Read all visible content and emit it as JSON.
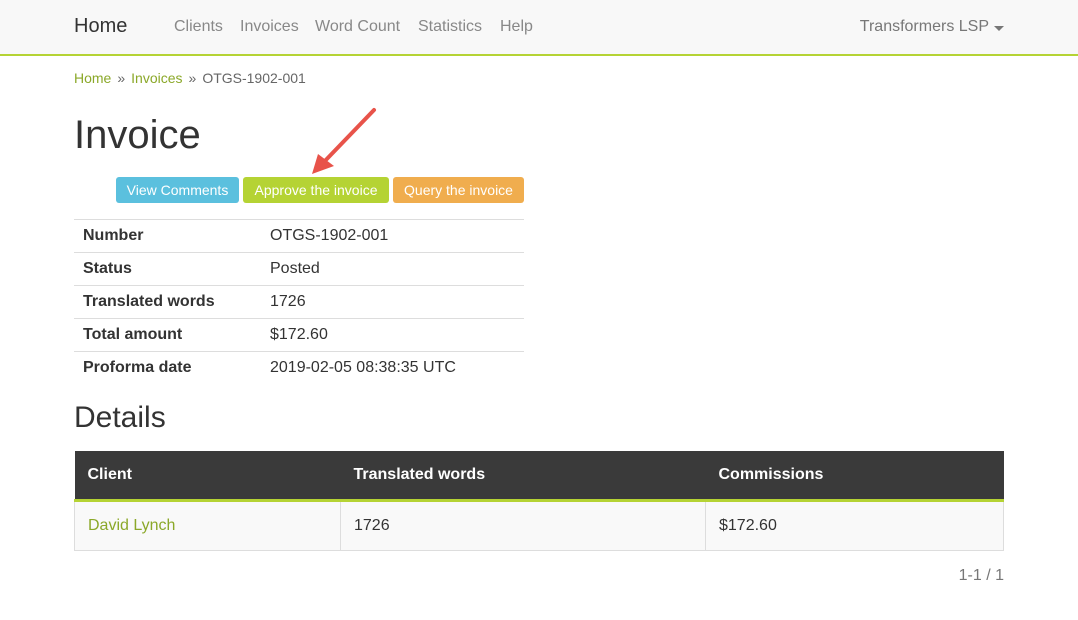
{
  "navbar": {
    "brand": "Home",
    "links": [
      "Clients",
      "Invoices",
      "Word Count",
      "Statistics",
      "Help"
    ],
    "user": "Transformers LSP"
  },
  "breadcrumb": {
    "home": "Home",
    "separator": "»",
    "invoices": "Invoices",
    "current": "OTGS-1902-001"
  },
  "title": "Invoice",
  "actions": {
    "view_comments": "View Comments",
    "approve": "Approve the invoice",
    "query": "Query the invoice"
  },
  "info": [
    {
      "key": "Number",
      "value": "OTGS-1902-001"
    },
    {
      "key": "Status",
      "value": "Posted"
    },
    {
      "key": "Translated words",
      "value": "1726"
    },
    {
      "key": "Total amount",
      "value": "$172.60"
    },
    {
      "key": "Proforma date",
      "value": "2019-02-05 08:38:35 UTC"
    }
  ],
  "details": {
    "title": "Details",
    "headers": [
      "Client",
      "Translated words",
      "Commissions"
    ],
    "rows": [
      {
        "client": "David Lynch",
        "words": "1726",
        "commissions": "$172.60"
      }
    ]
  },
  "pagination": "1-1 / 1",
  "colors": {
    "accent": "#b5d334",
    "info": "#5bc0de",
    "warning": "#f0ad4e",
    "link": "#8ba829",
    "annotation_arrow": "#e8534a"
  },
  "annotation": {
    "arrow": "arrow pointing to approve button"
  }
}
